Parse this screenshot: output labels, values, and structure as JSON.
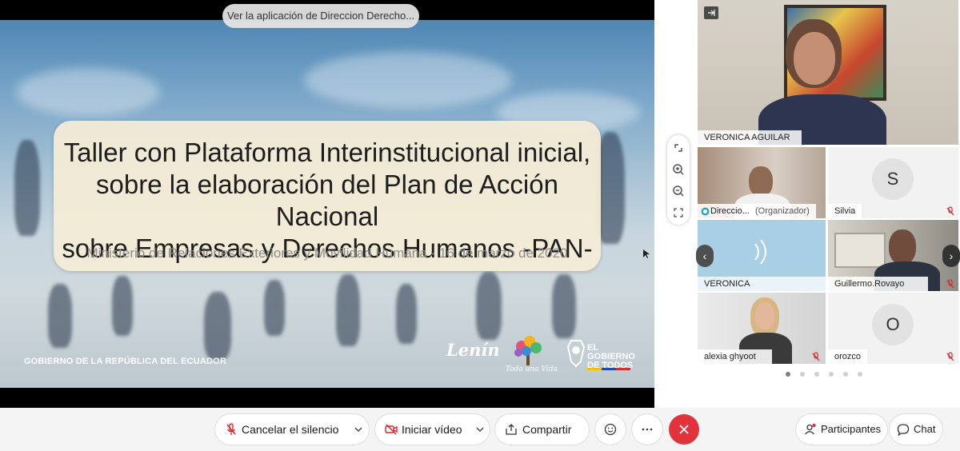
{
  "share": {
    "pill_label": "Ver la aplicación de Direccion Derecho...",
    "slide": {
      "title_line1": "Taller con Plataforma Interinstitucional inicial,",
      "title_line2": "sobre la elaboración del Plan de Acción Nacional",
      "title_line3": "sobre Empresas y Derechos Humanos -PAN-",
      "subtitle": "Ministerio de Relaciones Exteriores y Movilidad Humana  -  16 de marzo de 2020",
      "footer_left": "GOBIERNO DE LA REPÚBLICA DEL ECUADOR",
      "logo_lenin": "Lenín",
      "logo_tree_caption": "Toda una Vida",
      "logo_gob_line1": "EL",
      "logo_gob_line2": "GOBIERNO",
      "logo_gob_line3": "DE TODOS"
    }
  },
  "zoom_controls": [
    "fit-screen-icon",
    "zoom-in-icon",
    "zoom-out-icon",
    "fullscreen-icon"
  ],
  "participants": {
    "active_speaker": {
      "name": "VERONICA AGUILAR"
    },
    "tiles": [
      {
        "name": "Direccio...",
        "role": "(Organizador)"
      },
      {
        "name": "Silvia",
        "initial": "S",
        "muted": true
      },
      {
        "name": "VERONICA AGUILAR"
      },
      {
        "name": "Guillermo.Rovayo",
        "muted": true
      },
      {
        "name": "alexia ghyoot",
        "muted": true
      },
      {
        "name": "orozco",
        "initial": "O",
        "muted": true
      }
    ],
    "pages": {
      "count": 6,
      "active": 1
    }
  },
  "toolbar": {
    "unmute_label": "Cancelar el silencio",
    "video_label": "Iniciar vídeo",
    "share_label": "Compartir",
    "participants_label": "Participantes",
    "chat_label": "Chat"
  },
  "colors": {
    "end_call": "#e0333b",
    "mute_red": "#d9262c",
    "panel_accent": "#a9cfe4"
  }
}
